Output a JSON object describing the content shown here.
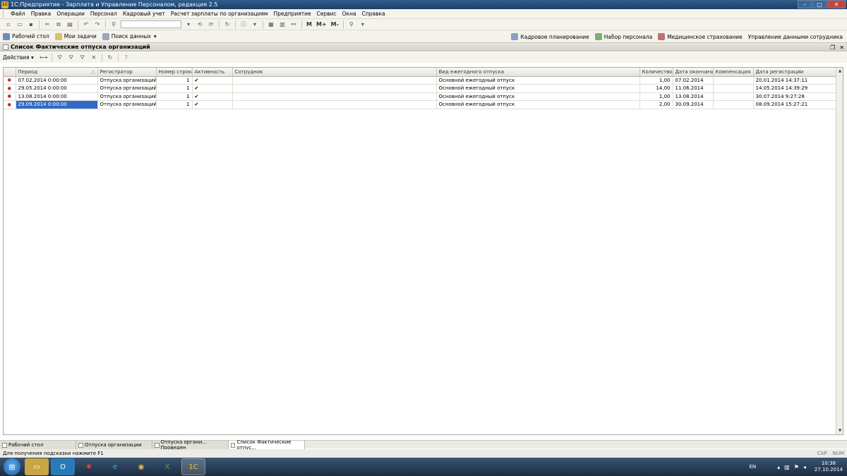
{
  "window": {
    "title": "1С:Предприятие - Зарплата и Управление Персоналом, редакция 2.5",
    "app_icon": "1C",
    "min_icon": "–",
    "max_icon": "□",
    "close_icon": "✕"
  },
  "menu": [
    "Файл",
    "Правка",
    "Операции",
    "Персонал",
    "Кадровый учет",
    "Расчет зарплаты по организациям",
    "Предприятие",
    "Сервис",
    "Окна",
    "Справка"
  ],
  "toolbar": {
    "m_label": "М",
    "mplus_label": "М+",
    "mminus_label": "М-"
  },
  "panel": {
    "left": [
      "Рабочий стол",
      "Мои задачи",
      "Поиск данных"
    ],
    "right": [
      "Кадровое планирование",
      "Набор персонала",
      "Медицинское страхование",
      "Управление данными сотрудника"
    ]
  },
  "document": {
    "title": "Список Фактические отпуска организаций",
    "restore_icon": "❐",
    "close_icon": "✕"
  },
  "actions": {
    "label": "Действия ▾"
  },
  "table": {
    "columns": [
      "",
      "Период",
      "Регистратор",
      "Номер строки",
      "Активность",
      "Сотрудник",
      "Вид ежегодного отпуска",
      "Количество",
      "Дата окончания",
      "Компенсация",
      "Дата регистрации"
    ],
    "rows": [
      {
        "mark": "●",
        "period": "07.02.2014 0:00:00",
        "registrator": "Отпуска организаций ...",
        "line": "1",
        "active": "✔",
        "employee": "",
        "kind": "Основной ежегодный отпуск",
        "qty": "1,00",
        "end": "07.02.2014",
        "comp": "",
        "reg": "20.01.2014 14:37:11"
      },
      {
        "mark": "●",
        "period": "29.05.2014 0:00:00",
        "registrator": "Отпуска организаций ...",
        "line": "1",
        "active": "✔",
        "employee": "",
        "kind": "Основной ежегодный отпуск",
        "qty": "14,00",
        "end": "11.06.2014",
        "comp": "",
        "reg": "14.05.2014 14:39:29"
      },
      {
        "mark": "●",
        "period": "13.08.2014 0:00:00",
        "registrator": "Отпуска организаций ...",
        "line": "1",
        "active": "✔",
        "employee": "",
        "kind": "Основной ежегодный отпуск",
        "qty": "1,00",
        "end": "13.08.2014",
        "comp": "",
        "reg": "30.07.2014 9:27:28"
      },
      {
        "mark": "●",
        "period": "29.09.2014 0:00:00",
        "registrator": "Отпуска организаций ...",
        "line": "1",
        "active": "✔",
        "employee": "",
        "kind": "Основной ежегодный отпуск",
        "qty": "2,00",
        "end": "30.09.2014",
        "comp": "",
        "reg": "08.09.2014 15:27:21"
      }
    ]
  },
  "window_tabs": [
    "Рабочий стол",
    "Отпуска организации",
    "Отпуска органи... Проведен",
    "Список Фактические отпус..."
  ],
  "status": {
    "hint": "Для получения подсказки нажмите F1",
    "cap": "CAP",
    "num": "NUM"
  },
  "taskbar": {
    "lang": "EN",
    "time": "10:38",
    "date": "27.10.2014"
  },
  "colors": {
    "selection": "#316ac5",
    "titlebar": "#2f5d8d"
  }
}
